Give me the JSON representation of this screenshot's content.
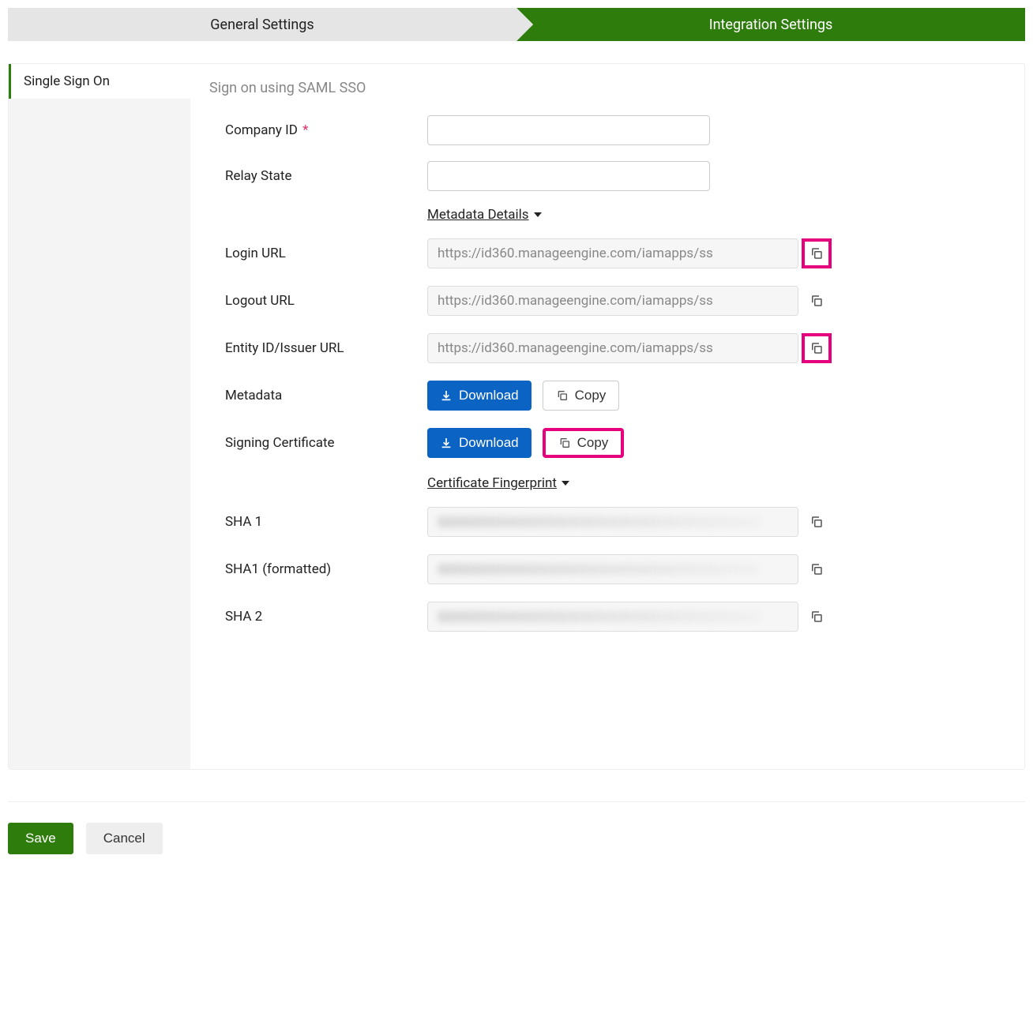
{
  "tabs": {
    "general": "General Settings",
    "integration": "Integration Settings"
  },
  "sidebar": {
    "sso": "Single Sign On"
  },
  "subtitle": "Sign on using SAML SSO",
  "labels": {
    "company_id": "Company ID",
    "relay_state": "Relay State",
    "metadata_details": "Metadata Details",
    "login_url": "Login URL",
    "logout_url": "Logout URL",
    "entity_id": "Entity ID/Issuer URL",
    "metadata": "Metadata",
    "signing_cert": "Signing Certificate",
    "cert_fingerprint": "Certificate Fingerprint",
    "sha1": "SHA 1",
    "sha1_formatted": "SHA1 (formatted)",
    "sha2": "SHA 2"
  },
  "values": {
    "company_id": "",
    "relay_state": "",
    "login_url": "https://id360.manageengine.com/iamapps/ss",
    "logout_url": "https://id360.manageengine.com/iamapps/ss",
    "entity_id": "https://id360.manageengine.com/iamapps/ss",
    "sha1": "",
    "sha1_formatted": "",
    "sha2": ""
  },
  "buttons": {
    "download": "Download",
    "copy": "Copy",
    "save": "Save",
    "cancel": "Cancel"
  },
  "required_marker": "*"
}
